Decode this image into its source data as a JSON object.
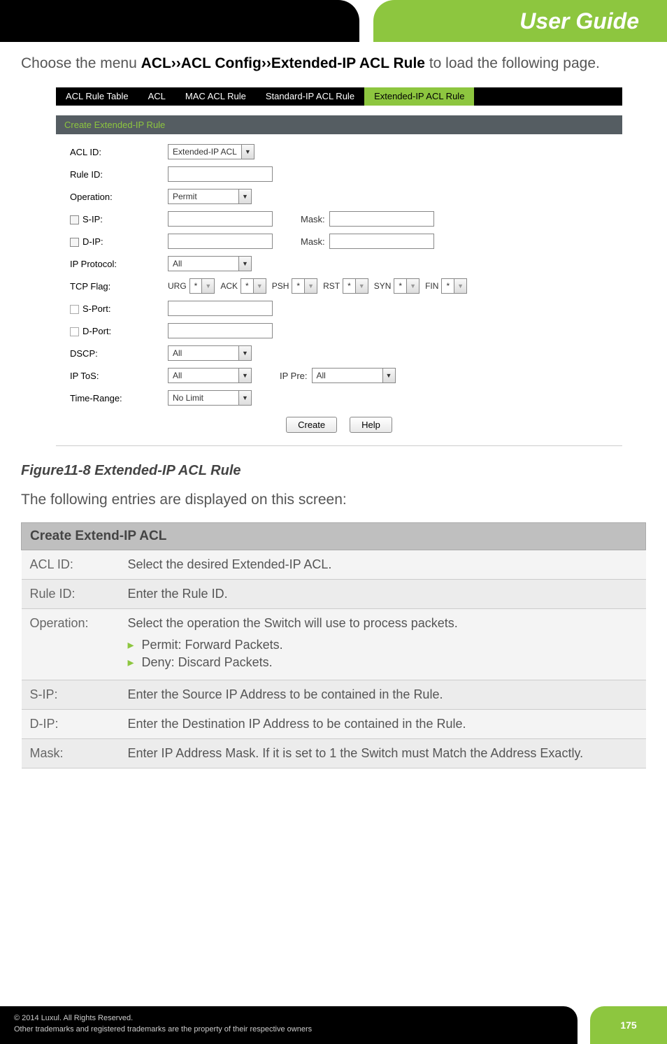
{
  "header": {
    "title": "User Guide"
  },
  "intro": {
    "prefix": "Choose the menu ",
    "path": "ACL››ACL Config››Extended-IP ACL Rule",
    "suffix": " to load the following page."
  },
  "tabs": {
    "items": [
      "ACL Rule Table",
      "ACL",
      "MAC ACL Rule",
      "Standard-IP ACL Rule",
      "Extended-IP ACL Rule"
    ],
    "active_index": 4
  },
  "section_header": "Create Extended-IP Rule",
  "form": {
    "acl_id": {
      "label": "ACL ID:",
      "value": "Extended-IP ACL"
    },
    "rule_id": {
      "label": "Rule ID:",
      "value": ""
    },
    "operation": {
      "label": "Operation:",
      "value": "Permit"
    },
    "sip": {
      "label": "S-IP:",
      "value": "",
      "mask_label": "Mask:",
      "mask_value": ""
    },
    "dip": {
      "label": "D-IP:",
      "value": "",
      "mask_label": "Mask:",
      "mask_value": ""
    },
    "ip_protocol": {
      "label": "IP Protocol:",
      "value": "All"
    },
    "tcp_flag": {
      "label": "TCP Flag:",
      "flags": [
        {
          "name": "URG",
          "value": "*"
        },
        {
          "name": "ACK",
          "value": "*"
        },
        {
          "name": "PSH",
          "value": "*"
        },
        {
          "name": "RST",
          "value": "*"
        },
        {
          "name": "SYN",
          "value": "*"
        },
        {
          "name": "FIN",
          "value": "*"
        }
      ]
    },
    "s_port": {
      "label": "S-Port:",
      "value": ""
    },
    "d_port": {
      "label": "D-Port:",
      "value": ""
    },
    "dscp": {
      "label": "DSCP:",
      "value": "All"
    },
    "ip_tos": {
      "label": "IP ToS:",
      "value": "All",
      "pre_label": "IP Pre:",
      "pre_value": "All"
    },
    "time_range": {
      "label": "Time-Range:",
      "value": "No Limit"
    },
    "buttons": {
      "create": "Create",
      "help": "Help"
    }
  },
  "figure_caption": "Figure11-8 Extended-IP ACL Rule",
  "desc_text": "The following entries are displayed on this screen:",
  "table": {
    "header": "Create Extend-IP ACL",
    "rows": [
      {
        "label": "ACL ID:",
        "desc": "Select the desired Extended-IP ACL.",
        "bullets": []
      },
      {
        "label": "Rule ID:",
        "desc": "Enter the Rule ID.",
        "bullets": []
      },
      {
        "label": "Operation:",
        "desc": "Select the operation the Switch will use to process packets.",
        "bullets": [
          "Permit: Forward Packets.",
          "Deny: Discard Packets."
        ]
      },
      {
        "label": "S-IP:",
        "desc": "Enter the Source IP Address to be contained in the Rule.",
        "bullets": []
      },
      {
        "label": "D-IP:",
        "desc": "Enter the Destination IP Address to be contained in the Rule.",
        "bullets": []
      },
      {
        "label": "Mask:",
        "desc": "Enter IP Address Mask. If it is set to 1 the Switch must Match the Address Exactly.",
        "bullets": []
      }
    ]
  },
  "footer": {
    "copyright": "© 2014  Luxul. All Rights Reserved.",
    "trademark": "Other trademarks and registered trademarks are the property of their respective owners",
    "page": "175"
  }
}
